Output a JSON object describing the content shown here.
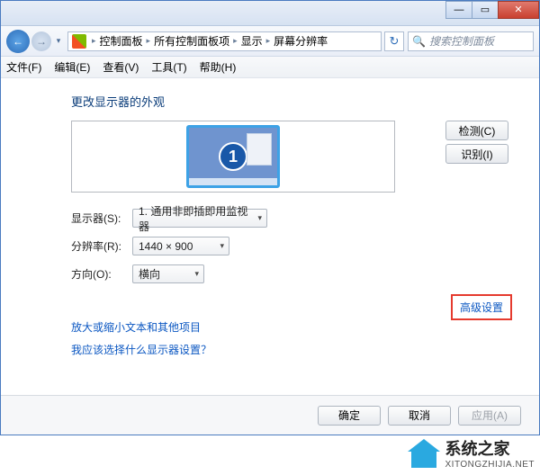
{
  "window": {
    "min": "—",
    "max": "▭",
    "close": "✕"
  },
  "nav": {
    "back_arrow": "←",
    "forward_arrow": "→",
    "drop": "▾",
    "refresh": "↻",
    "search_placeholder": "搜索控制面板",
    "breadcrumb": [
      "控制面板",
      "所有控制面板项",
      "显示",
      "屏幕分辨率"
    ]
  },
  "menu": {
    "items": [
      "文件(F)",
      "编辑(E)",
      "查看(V)",
      "工具(T)",
      "帮助(H)"
    ]
  },
  "content": {
    "title": "更改显示器的外观",
    "monitor_number": "1",
    "detect_btn": "检测(C)",
    "identify_btn": "识别(I)",
    "display_label": "显示器(S):",
    "display_value": "1. 通用非即插即用监视器",
    "resolution_label": "分辨率(R):",
    "resolution_value": "1440 × 900",
    "orientation_label": "方向(O):",
    "orientation_value": "横向",
    "advanced_link": "高级设置",
    "footer_link1": "放大或缩小文本和其他项目",
    "footer_link2": "我应该选择什么显示器设置？"
  },
  "buttons": {
    "ok": "确定",
    "cancel": "取消",
    "apply": "应用(A)"
  },
  "watermark": {
    "name": "系统之家",
    "url": "XITONGZHIJIA.NET"
  }
}
